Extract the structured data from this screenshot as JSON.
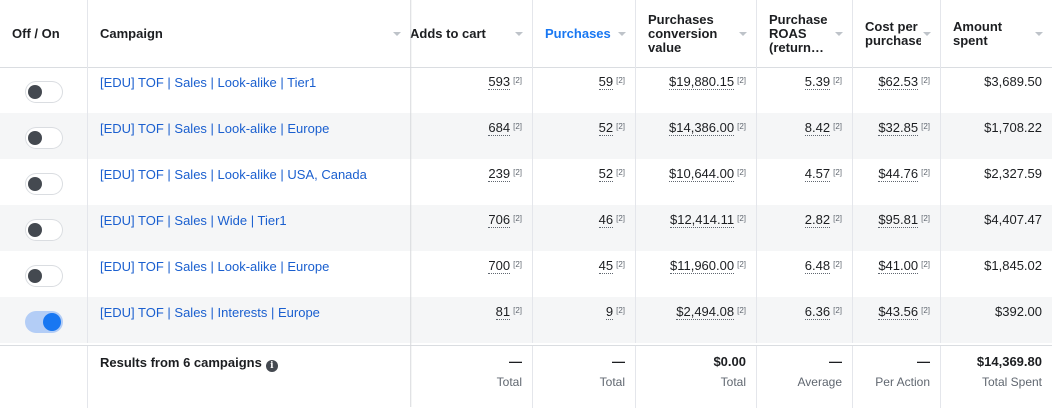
{
  "columns": {
    "off_on": "Off / On",
    "campaign": "Campaign",
    "adds_to_cart": "Adds to cart",
    "purchases": "Purchases",
    "pcv": "Purchases conversion value",
    "pcv_l1": "Purchases",
    "pcv_l2": "conversion",
    "pcv_l3": "value",
    "roas_l1": "Purchase",
    "roas_l2": "ROAS",
    "roas_l3": "(return…",
    "cpp_l1": "Cost per",
    "cpp_l2": "purchase",
    "amt_l1": "Amount",
    "amt_l2": "spent"
  },
  "footnote_marker": "[2]",
  "rows": [
    {
      "on": false,
      "campaign": "[EDU] TOF | Sales | Look-alike | Tier1",
      "adds": "593",
      "purchases": "59",
      "pcv": "$19,880.15",
      "roas": "5.39",
      "cpp": "$62.53",
      "amount": "$3,689.50"
    },
    {
      "on": false,
      "campaign": "[EDU] TOF | Sales | Look-alike | Europe",
      "adds": "684",
      "purchases": "52",
      "pcv": "$14,386.00",
      "roas": "8.42",
      "cpp": "$32.85",
      "amount": "$1,708.22"
    },
    {
      "on": false,
      "campaign": "[EDU] TOF | Sales | Look-alike | USA, Canada",
      "adds": "239",
      "purchases": "52",
      "pcv": "$10,644.00",
      "roas": "4.57",
      "cpp": "$44.76",
      "amount": "$2,327.59"
    },
    {
      "on": false,
      "campaign": "[EDU] TOF | Sales | Wide | Tier1",
      "adds": "706",
      "purchases": "46",
      "pcv": "$12,414.11",
      "roas": "2.82",
      "cpp": "$95.81",
      "amount": "$4,407.47"
    },
    {
      "on": false,
      "campaign": "[EDU] TOF | Sales | Look-alike | Europe",
      "adds": "700",
      "purchases": "45",
      "pcv": "$11,960.00",
      "roas": "6.48",
      "cpp": "$41.00",
      "amount": "$1,845.02"
    },
    {
      "on": true,
      "campaign": "[EDU] TOF | Sales | Interests | Europe",
      "adds": "81",
      "purchases": "9",
      "pcv": "$2,494.08",
      "roas": "6.36",
      "cpp": "$43.56",
      "amount": "$392.00"
    }
  ],
  "summary": {
    "label": "Results from 6 campaigns",
    "info_icon": "info-icon",
    "adds": "—",
    "adds_sub": "Total",
    "purchases": "—",
    "purchases_sub": "Total",
    "pcv": "$0.00",
    "pcv_sub": "Total",
    "roas": "—",
    "roas_sub": "Average",
    "cpp": "—",
    "cpp_sub": "Per Action",
    "amount": "$14,369.80",
    "amount_sub": "Total Spent"
  },
  "colors": {
    "accent": "#1877f2",
    "link": "#1a5fcf"
  }
}
